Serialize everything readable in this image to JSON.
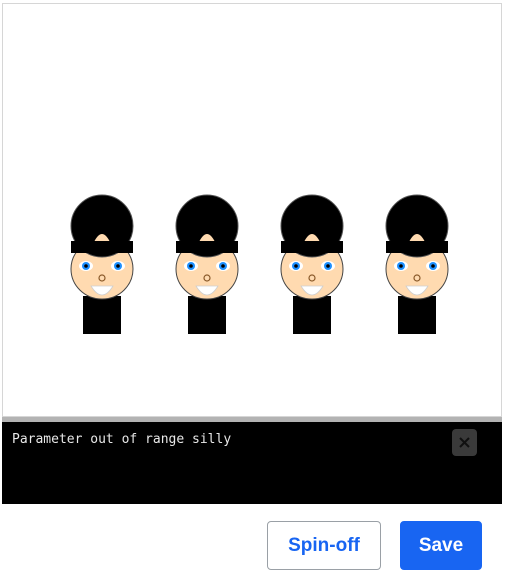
{
  "canvas": {
    "figure_count": 4,
    "figure_description": "cartoon guard with black busby hat, face and black body",
    "colors": {
      "hat": "#000000",
      "face": "#ffdab0",
      "eye_white": "#ffffff",
      "iris": "#1e90ff",
      "pupil": "#000000",
      "mouth": "#ffffff",
      "body": "#000000"
    }
  },
  "console": {
    "message": "Parameter out of range silly",
    "close_icon": "close-icon",
    "background": "#000000"
  },
  "actions": {
    "spinoff_label": "Spin-off",
    "save_label": "Save",
    "accent": "#1865f2"
  }
}
